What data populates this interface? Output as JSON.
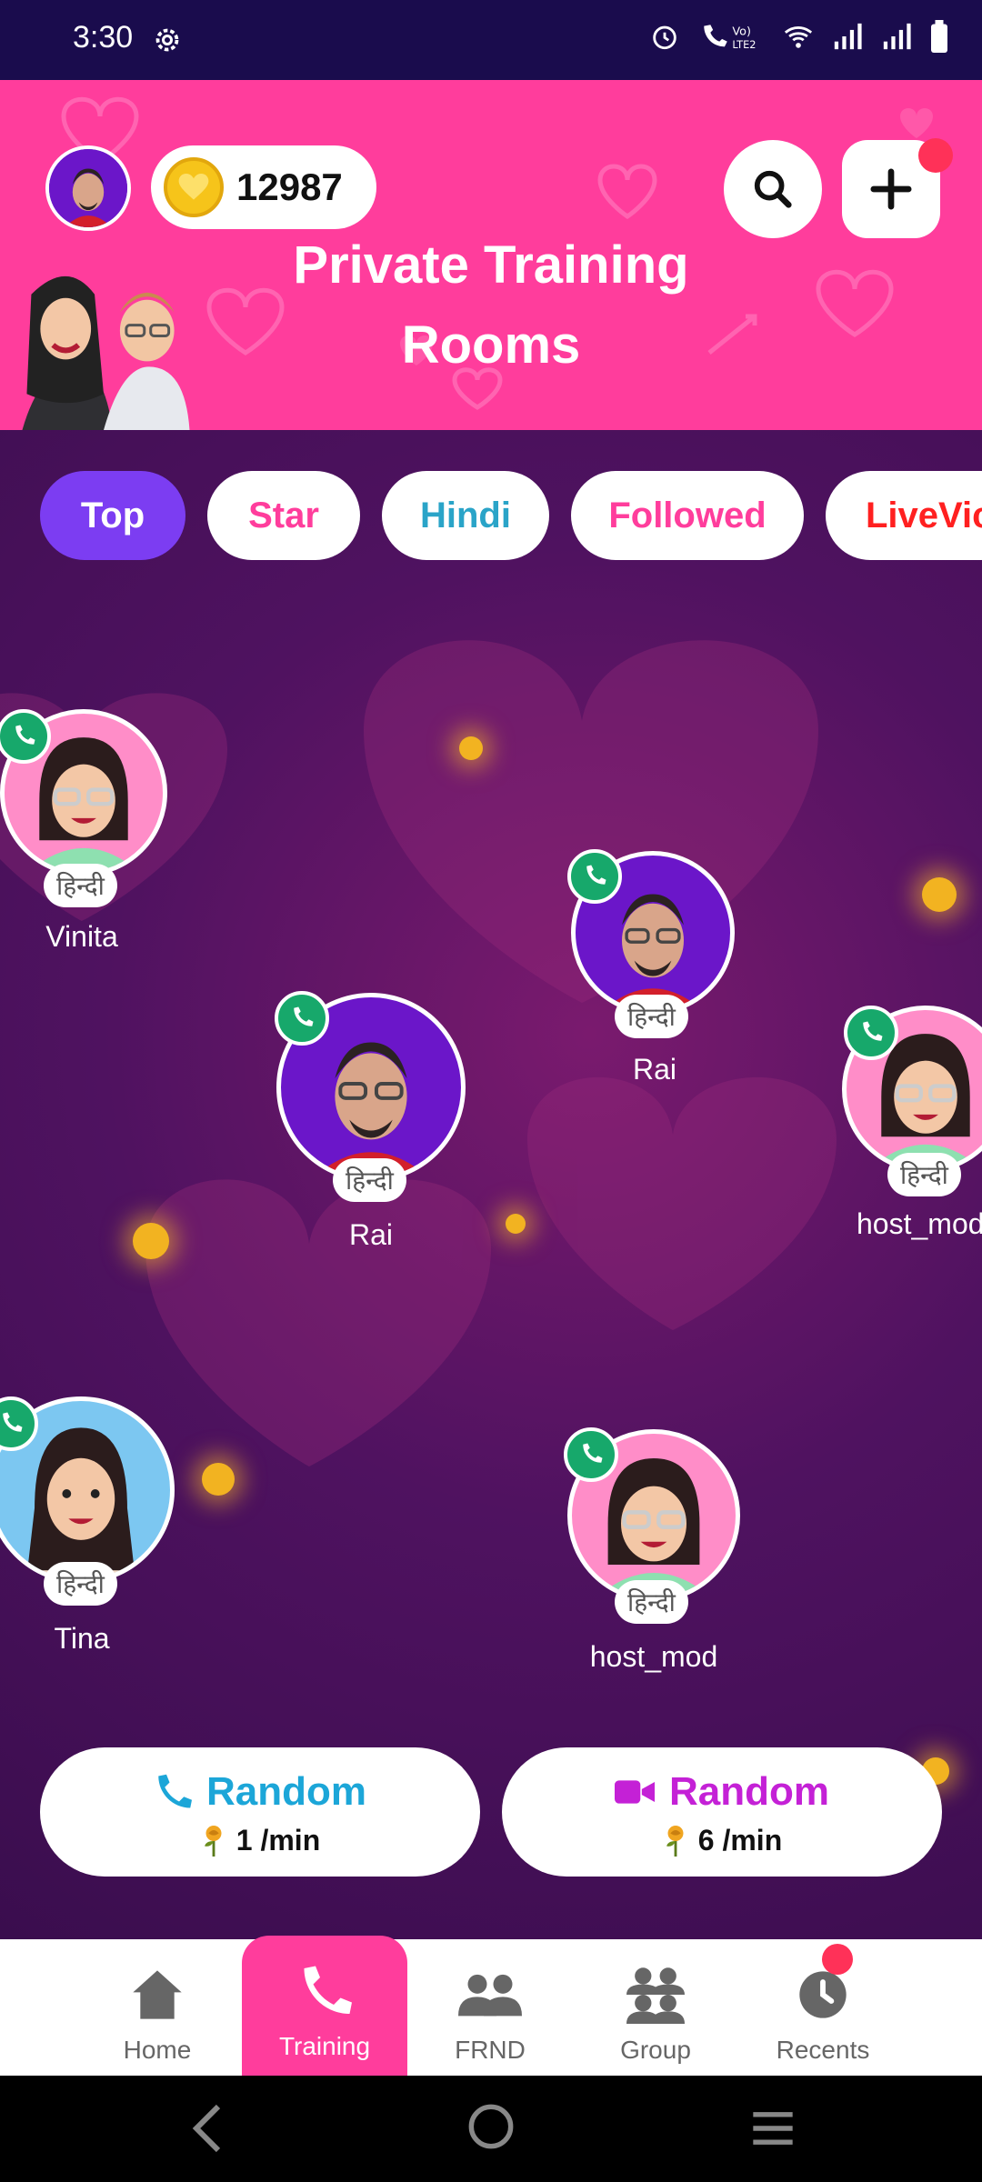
{
  "status_bar": {
    "time": "3:30",
    "icons": [
      "alarm-icon",
      "volte-call-icon",
      "wifi-icon",
      "signal-icon",
      "signal-icon",
      "battery-icon"
    ]
  },
  "header": {
    "coin_count": "12987",
    "title": "Private Training Rooms",
    "accent": "#ff3d9c"
  },
  "tabs": [
    {
      "label": "Top",
      "active": true
    },
    {
      "label": "Star"
    },
    {
      "label": "Hindi"
    },
    {
      "label": "Followed"
    },
    {
      "label": "LiveVic"
    }
  ],
  "hosts": [
    {
      "name": "Vinita",
      "lang": "हिन्दी",
      "avatar": "female-glasses"
    },
    {
      "name": "Rai",
      "lang": "हिन्दी",
      "avatar": "male-beard"
    },
    {
      "name": "Rai",
      "lang": "हिन्दी",
      "avatar": "male-beard"
    },
    {
      "name": "host_mod",
      "lang": "हिन्दी",
      "avatar": "female-glasses"
    },
    {
      "name": "Tina",
      "lang": "हिन्दी",
      "avatar": "female-long-hair"
    },
    {
      "name": "host_mod",
      "lang": "हिन्दी",
      "avatar": "female-glasses"
    }
  ],
  "random_audio": {
    "label": "Random",
    "price": "1 /min",
    "color": "#1ca6d8"
  },
  "random_video": {
    "label": "Random",
    "price": "6 /min",
    "color": "#c421d6"
  },
  "bottom_nav": [
    {
      "label": "Home",
      "icon": "home-icon"
    },
    {
      "label": "Training",
      "icon": "phone-icon",
      "active": true
    },
    {
      "label": "FRND",
      "icon": "friends-icon"
    },
    {
      "label": "Group",
      "icon": "group-icon"
    },
    {
      "label": "Recents",
      "icon": "clock-icon"
    }
  ]
}
